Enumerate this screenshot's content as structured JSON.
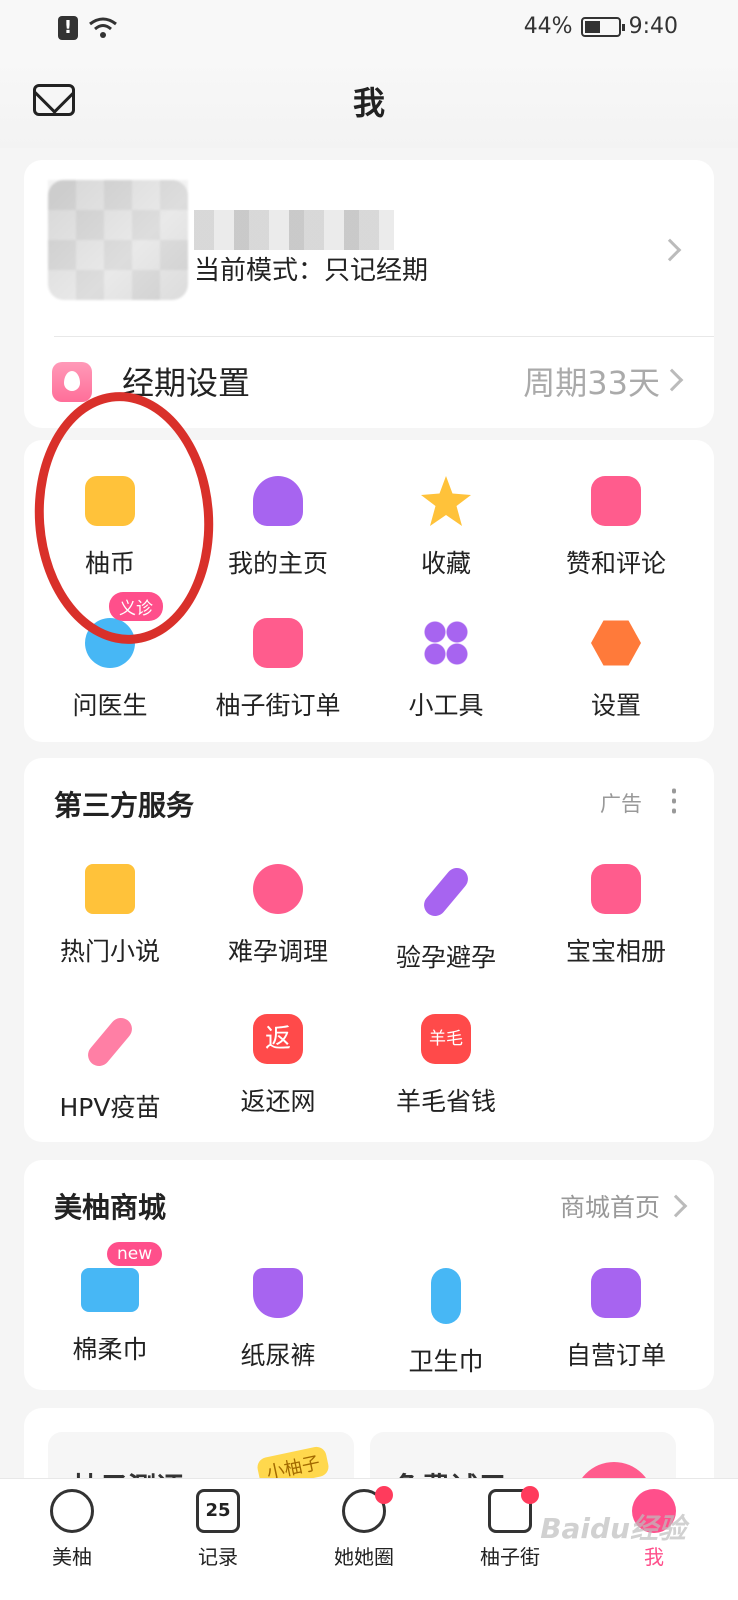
{
  "status_bar": {
    "battery": "44%",
    "time": "9:40"
  },
  "header": {
    "title": "我"
  },
  "profile": {
    "mode_text": "当前模式：只记经期"
  },
  "period": {
    "label": "经期设置",
    "value": "周期33天"
  },
  "menu": {
    "items": [
      {
        "label": "柚币",
        "icon": "coin-icon",
        "color": "#ffc23a"
      },
      {
        "label": "我的主页",
        "icon": "user-icon",
        "color": "#a764f0"
      },
      {
        "label": "收藏",
        "icon": "star-icon",
        "color": "#ffc23a"
      },
      {
        "label": "赞和评论",
        "icon": "thumbs-up-icon",
        "color": "#ff5c8d"
      },
      {
        "label": "问医生",
        "icon": "doctor-chat-icon",
        "color": "#47b7f5",
        "badge": "义诊"
      },
      {
        "label": "柚子街订单",
        "icon": "order-icon",
        "color": "#ff5c8d"
      },
      {
        "label": "小工具",
        "icon": "tools-icon",
        "color": "#a764f0"
      },
      {
        "label": "设置",
        "icon": "settings-icon",
        "color": "#ff7a3a"
      }
    ]
  },
  "third_party": {
    "title": "第三方服务",
    "ad_label": "广告",
    "items": [
      {
        "label": "热门小说",
        "icon": "book-icon",
        "color": "#ffc23a"
      },
      {
        "label": "难孕调理",
        "icon": "heart-bag-icon",
        "color": "#ff5c8d"
      },
      {
        "label": "验孕避孕",
        "icon": "test-strip-icon",
        "color": "#a764f0"
      },
      {
        "label": "宝宝相册",
        "icon": "baby-album-icon",
        "color": "#ff5c8d"
      },
      {
        "label": "HPV疫苗",
        "icon": "vaccine-icon",
        "color": "#ff7fa5"
      },
      {
        "label": "返还网",
        "icon": "cashback-icon",
        "color": "#ff4a4a",
        "glyph": "返"
      },
      {
        "label": "羊毛省钱",
        "icon": "savings-icon",
        "color": "#ff4a4a",
        "glyph": "羊毛"
      }
    ]
  },
  "mall": {
    "title": "美柚商城",
    "link": "商城首页",
    "items": [
      {
        "label": "棉柔巾",
        "icon": "cotton-towel-icon",
        "color": "#47b7f5",
        "badge": "new"
      },
      {
        "label": "纸尿裤",
        "icon": "diaper-icon",
        "color": "#a764f0"
      },
      {
        "label": "卫生巾",
        "icon": "pad-icon",
        "color": "#47b7f5"
      },
      {
        "label": "自营订单",
        "icon": "self-order-icon",
        "color": "#a764f0"
      }
    ]
  },
  "promo": {
    "left_text": "柚子测评",
    "left_sticker": "小柚子",
    "right_text": "免费试用"
  },
  "tabbar": {
    "items": [
      {
        "label": "美柚",
        "icon": "meiyou-icon"
      },
      {
        "label": "记录",
        "icon": "calendar-icon",
        "number": "25"
      },
      {
        "label": "她她圈",
        "icon": "community-icon",
        "dot": true
      },
      {
        "label": "柚子街",
        "icon": "shop-bag-icon",
        "dot": true
      },
      {
        "label": "我",
        "icon": "profile-icon",
        "active": true
      }
    ]
  },
  "watermark": "Baidu经验"
}
